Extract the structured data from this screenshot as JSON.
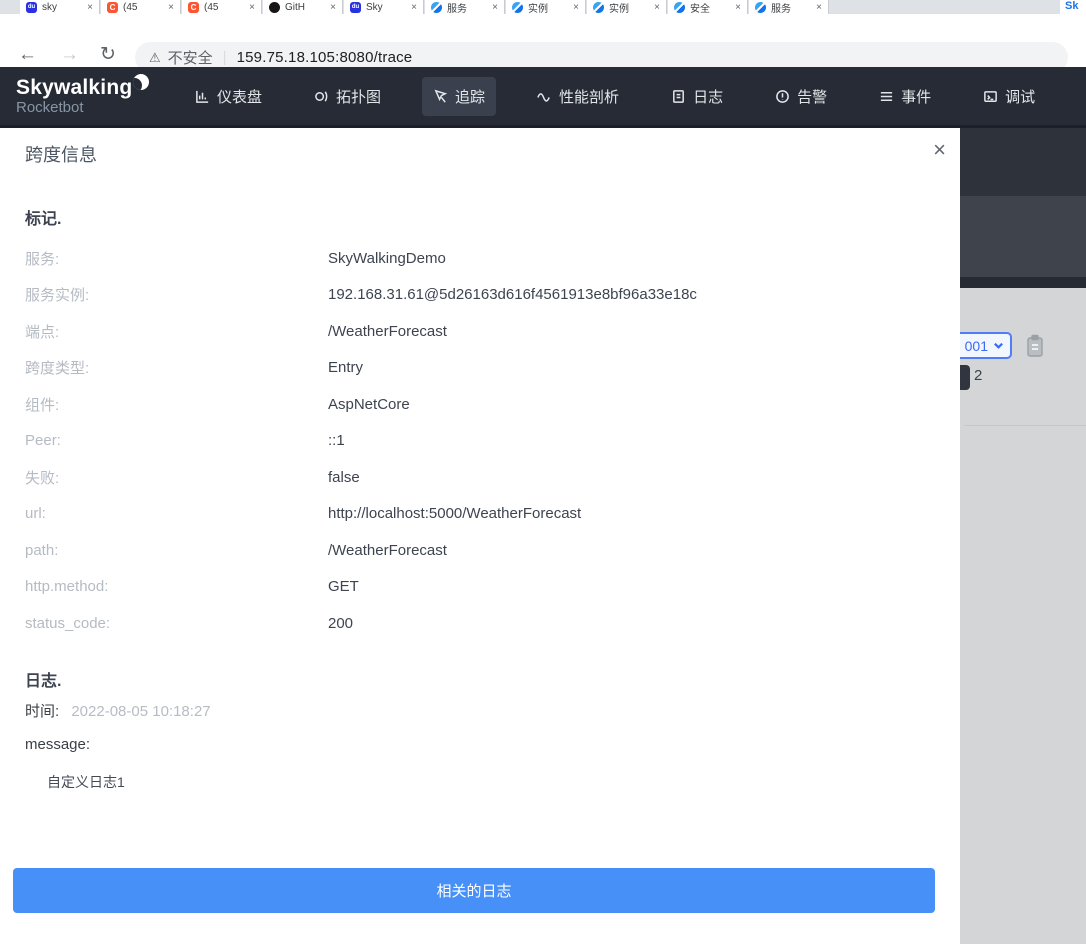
{
  "browser": {
    "tabs": [
      {
        "site": "baidu",
        "label": "sky"
      },
      {
        "site": "csdn",
        "label": "(45"
      },
      {
        "site": "csdn",
        "label": "(45"
      },
      {
        "site": "github",
        "label": "GitH"
      },
      {
        "site": "baidu",
        "label": "Sky"
      },
      {
        "site": "tencent",
        "label": "服务"
      },
      {
        "site": "tencent",
        "label": "实例"
      },
      {
        "site": "tencent",
        "label": "实例"
      },
      {
        "site": "tencent",
        "label": "安全"
      },
      {
        "site": "tencent",
        "label": "服务"
      }
    ],
    "partial_tab_label": "Sk",
    "close_glyph": "×",
    "back_glyph": "←",
    "forward_glyph": "→",
    "reload_glyph": "↻",
    "warning_glyph": "⚠",
    "security_label": "不安全",
    "url_separator": "|",
    "url": "159.75.18.105:8080/trace"
  },
  "navbar": {
    "logo": "Skywalking",
    "logo_sub": "Rocketbot",
    "items": [
      {
        "label": "仪表盘"
      },
      {
        "label": "拓扑图"
      },
      {
        "label": "追踪"
      },
      {
        "label": "性能剖析"
      },
      {
        "label": "日志"
      },
      {
        "label": "告警"
      },
      {
        "label": "事件"
      },
      {
        "label": "调试"
      }
    ],
    "active_item": "追踪"
  },
  "modal": {
    "title": "跨度信息",
    "close_glyph": "×",
    "tags_heading": "标记.",
    "fields": [
      {
        "label": "服务:",
        "value": "SkyWalkingDemo"
      },
      {
        "label": "服务实例:",
        "value": "192.168.31.61@5d26163d616f4561913e8bf96a33e18c"
      },
      {
        "label": "端点:",
        "value": "/WeatherForecast"
      },
      {
        "label": "跨度类型:",
        "value": "Entry"
      },
      {
        "label": "组件:",
        "value": "AspNetCore"
      },
      {
        "label": "Peer:",
        "value": "::1"
      },
      {
        "label": "失败:",
        "value": "false"
      },
      {
        "label": "url:",
        "value": "http://localhost:5000/WeatherForecast"
      },
      {
        "label": "path:",
        "value": "/WeatherForecast"
      },
      {
        "label": "http.method:",
        "value": "GET"
      },
      {
        "label": "status_code:",
        "value": "200"
      }
    ],
    "logs_heading": "日志.",
    "time_label": "时间:",
    "time_value": "2022-08-05 10:18:27",
    "message_label": "message:",
    "message_value": "自定义日志1",
    "related_logs_button": "相关的日志"
  },
  "background_page": {
    "select_value": "001",
    "badge_count": "2"
  },
  "colors": {
    "navbar_bg": "#262b35",
    "active_menu_bg": "#3a404d",
    "button_blue": "#4790f8",
    "select_border_blue": "#4f7df5",
    "label_gray": "#b5bbc3",
    "value_dark": "#3d4450"
  }
}
